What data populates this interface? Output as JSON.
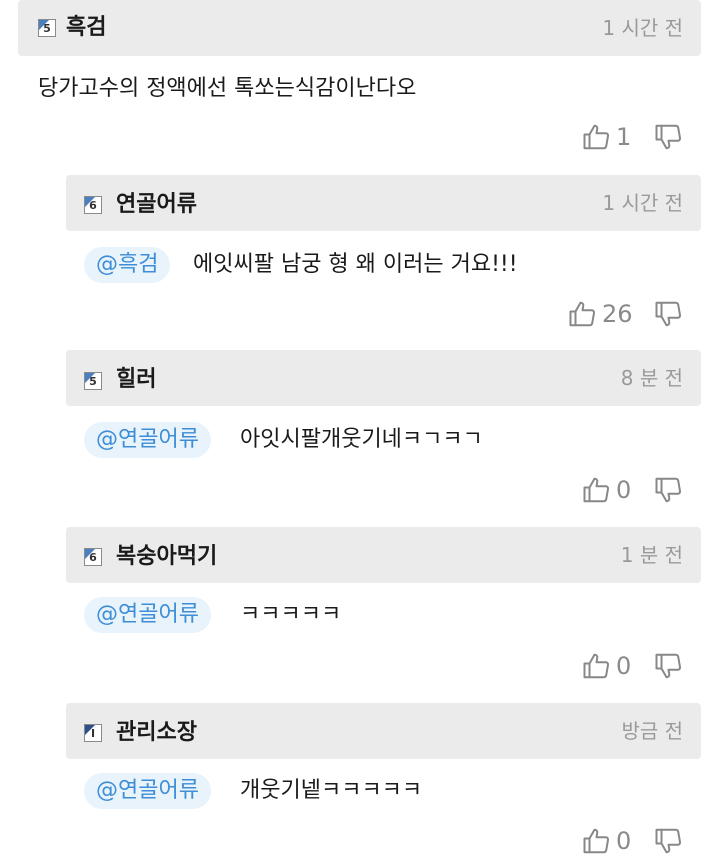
{
  "comments": [
    {
      "author": "흑검",
      "level": "5",
      "time": "1 시간 전",
      "text": "당가고수의 정액에선 톡쏘는식감이난다오",
      "likes": "1"
    },
    {
      "author": "연골어류",
      "level": "6",
      "time": "1 시간 전",
      "mention": "@흑검",
      "text": "에잇씨팔 남궁 형 왜 이러는 거요!!!",
      "likes": "26"
    },
    {
      "author": "힐러",
      "level": "5",
      "time": "8 분 전",
      "mention": "@연골어류",
      "text": "아잇시팔개웃기네ㅋㄱㅋㄱ",
      "likes": "0"
    },
    {
      "author": "복숭아먹기",
      "level": "6",
      "time": "1 분 전",
      "mention": "@연골어류",
      "text": "ㅋㅋㅋㅋㅋ",
      "likes": "0"
    },
    {
      "author": "관리소장",
      "level": "I",
      "time": "방금 전",
      "mention": "@연골어류",
      "text": "개웃기넽ㅋㅋㅋㅋㅋ",
      "likes": "0"
    }
  ],
  "colors": {
    "header_bg": "#ebebeb",
    "mention_bg": "#e8f3fb",
    "mention_text": "#3d8ed6",
    "level_badge": "#4a7fc1"
  },
  "icons": {
    "like": "thumbs-up-icon",
    "dislike": "thumbs-down-icon"
  }
}
